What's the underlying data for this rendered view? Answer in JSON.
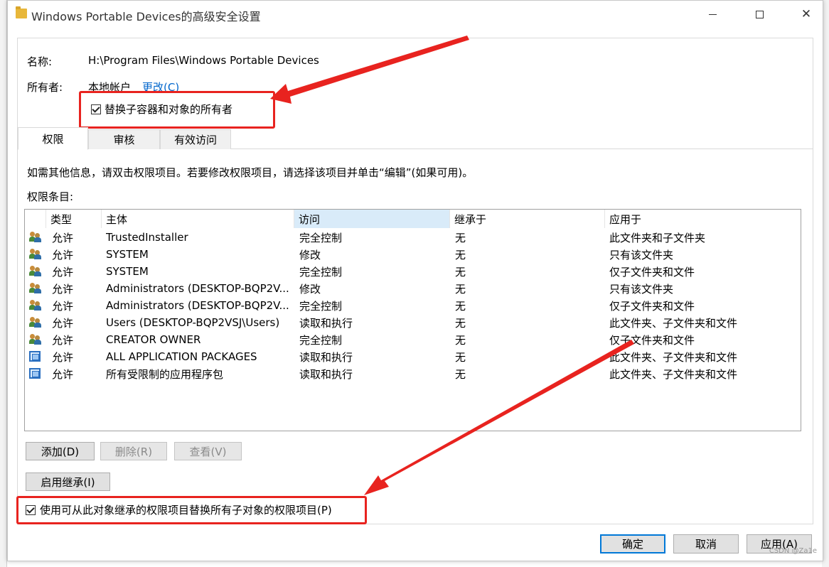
{
  "window": {
    "title": "Windows Portable Devices的高级安全设置",
    "minimize_icon": "minimize-icon",
    "maximize_icon": "maximize-icon",
    "close_icon": "close-icon",
    "close_glyph": "✕"
  },
  "info": {
    "name_label": "名称:",
    "name_value": "H:\\Program Files\\Windows Portable Devices",
    "owner_label": "所有者:",
    "owner_value": "本地帐户",
    "change_link": "更改(C)",
    "replace_owner_checkbox": "替换子容器和对象的所有者",
    "replace_owner_checked": true
  },
  "tabs": [
    {
      "label": "权限",
      "active": true
    },
    {
      "label": "审核",
      "active": false
    },
    {
      "label": "有效访问",
      "active": false
    }
  ],
  "permissions": {
    "hint": "如需其他信息，请双击权限项目。若要修改权限项目，请选择该项目并单击“编辑”(如果可用)。",
    "entries_label": "权限条目:",
    "columns": [
      "类型",
      "主体",
      "访问",
      "继承于",
      "应用于"
    ],
    "sorted_column": "访问",
    "rows": [
      {
        "icon": "users-icon",
        "type": "允许",
        "principal": "TrustedInstaller",
        "access": "完全控制",
        "inherited": "无",
        "applies": "此文件夹和子文件夹"
      },
      {
        "icon": "users-icon",
        "type": "允许",
        "principal": "SYSTEM",
        "access": "修改",
        "inherited": "无",
        "applies": "只有该文件夹"
      },
      {
        "icon": "users-icon",
        "type": "允许",
        "principal": "SYSTEM",
        "access": "完全控制",
        "inherited": "无",
        "applies": "仅子文件夹和文件"
      },
      {
        "icon": "users-icon",
        "type": "允许",
        "principal": "Administrators (DESKTOP-BQP2V...",
        "access": "修改",
        "inherited": "无",
        "applies": "只有该文件夹"
      },
      {
        "icon": "users-icon",
        "type": "允许",
        "principal": "Administrators (DESKTOP-BQP2V...",
        "access": "完全控制",
        "inherited": "无",
        "applies": "仅子文件夹和文件"
      },
      {
        "icon": "users-icon",
        "type": "允许",
        "principal": "Users (DESKTOP-BQP2VSJ\\Users)",
        "access": "读取和执行",
        "inherited": "无",
        "applies": "此文件夹、子文件夹和文件"
      },
      {
        "icon": "users-icon",
        "type": "允许",
        "principal": "CREATOR OWNER",
        "access": "完全控制",
        "inherited": "无",
        "applies": "仅子文件夹和文件"
      },
      {
        "icon": "package-icon",
        "type": "允许",
        "principal": "ALL APPLICATION PACKAGES",
        "access": "读取和执行",
        "inherited": "无",
        "applies": "此文件夹、子文件夹和文件"
      },
      {
        "icon": "package-icon",
        "type": "允许",
        "principal": "所有受限制的应用程序包",
        "access": "读取和执行",
        "inherited": "无",
        "applies": "此文件夹、子文件夹和文件"
      }
    ]
  },
  "buttons": {
    "add": "添加(D)",
    "remove": "删除(R)",
    "view": "查看(V)",
    "enable_inheritance": "启用继承(I)",
    "ok": "确定",
    "cancel": "取消",
    "apply": "应用(A)"
  },
  "replace_child_checkbox": "使用可从此对象继承的权限项目替换所有子对象的权限项目(P)",
  "replace_child_checked": true,
  "annotation_color": "#e8231f",
  "watermark": "CSDN @Za1e"
}
